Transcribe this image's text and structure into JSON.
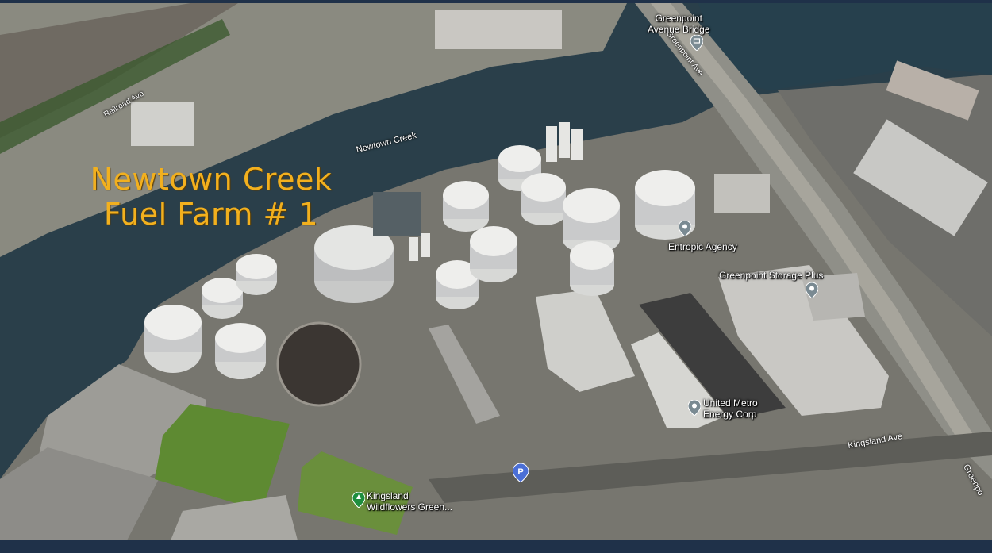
{
  "title": {
    "line1": "Newtown Creek",
    "line2": "Fuel Farm # 1",
    "color": "#f2b01e"
  },
  "waterway": {
    "label": "Newtown Creek"
  },
  "roads": {
    "railroad_ave": "Railroad Ave",
    "greenpoint_ave": "Greenpoint Ave",
    "kingsland_ave": "Kingsland Ave",
    "greenpoint_edge": "Greenpo"
  },
  "places": {
    "bridge": {
      "name_line1": "Greenpoint",
      "name_line2": "Avenue Bridge",
      "icon": "bridge-pin-icon"
    },
    "entropic": {
      "name": "Entropic Agency",
      "icon": "location-pin-icon"
    },
    "storage": {
      "name": "Greenpoint Storage Plus",
      "icon": "location-pin-icon"
    },
    "united_metro": {
      "name_line1": "United Metro",
      "name_line2": "Energy Corp",
      "icon": "location-pin-icon"
    },
    "kingsland_wildflowers": {
      "name_line1": "Kingsland",
      "name_line2": "Wildflowers Green...",
      "icon": "park-pin-icon"
    },
    "parking": {
      "icon": "parking-pin-icon"
    }
  },
  "colors": {
    "water": "#233a47",
    "frame": "#1f3149",
    "green_roof": "#5e8a32"
  }
}
